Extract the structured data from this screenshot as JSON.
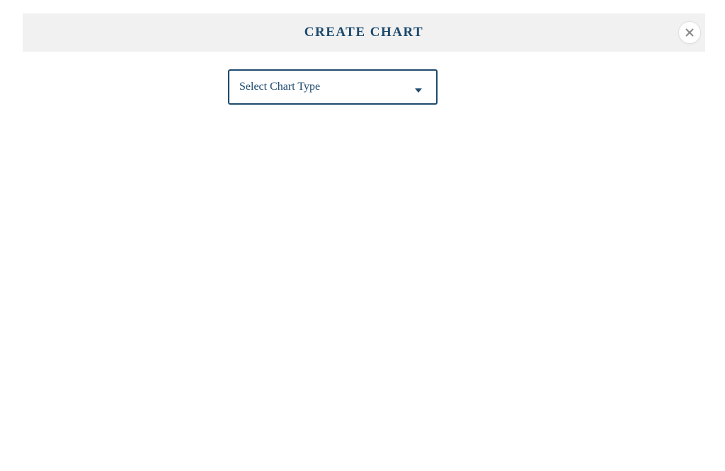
{
  "modal": {
    "title": "CREATE CHART",
    "select": {
      "placeholder": "Select Chart Type"
    }
  }
}
